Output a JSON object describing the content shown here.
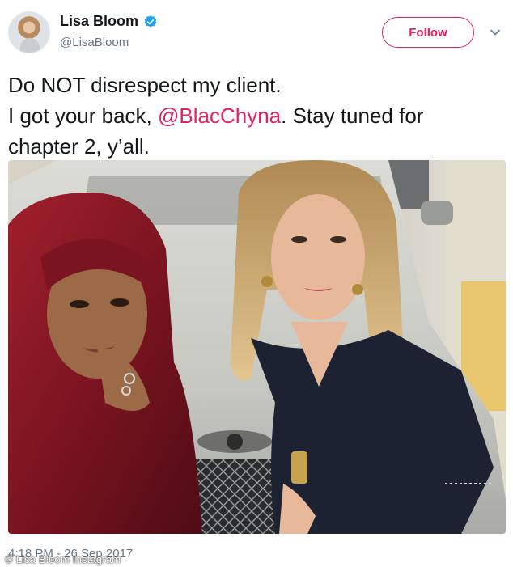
{
  "tweet": {
    "display_name": "Lisa Bloom",
    "handle": "@LisaBloom",
    "follow_label": "Follow",
    "text_before": "Do NOT disrespect my client.\nI got your back, ",
    "mention": "@BlacChyna",
    "text_after": ". Stay tuned for\nchapter 2, y’all.",
    "timestamp": "4:18 PM - 26 Sep 2017"
  },
  "photo_credit": "© Lisa Bloom Instagram",
  "colors": {
    "accent": "#e0245e",
    "verified_blue": "#1da1f2",
    "secondary_text": "#657786",
    "primary_text": "#14171a"
  },
  "icons": {
    "verified": "verified-badge-icon",
    "caret": "chevron-down-icon"
  }
}
